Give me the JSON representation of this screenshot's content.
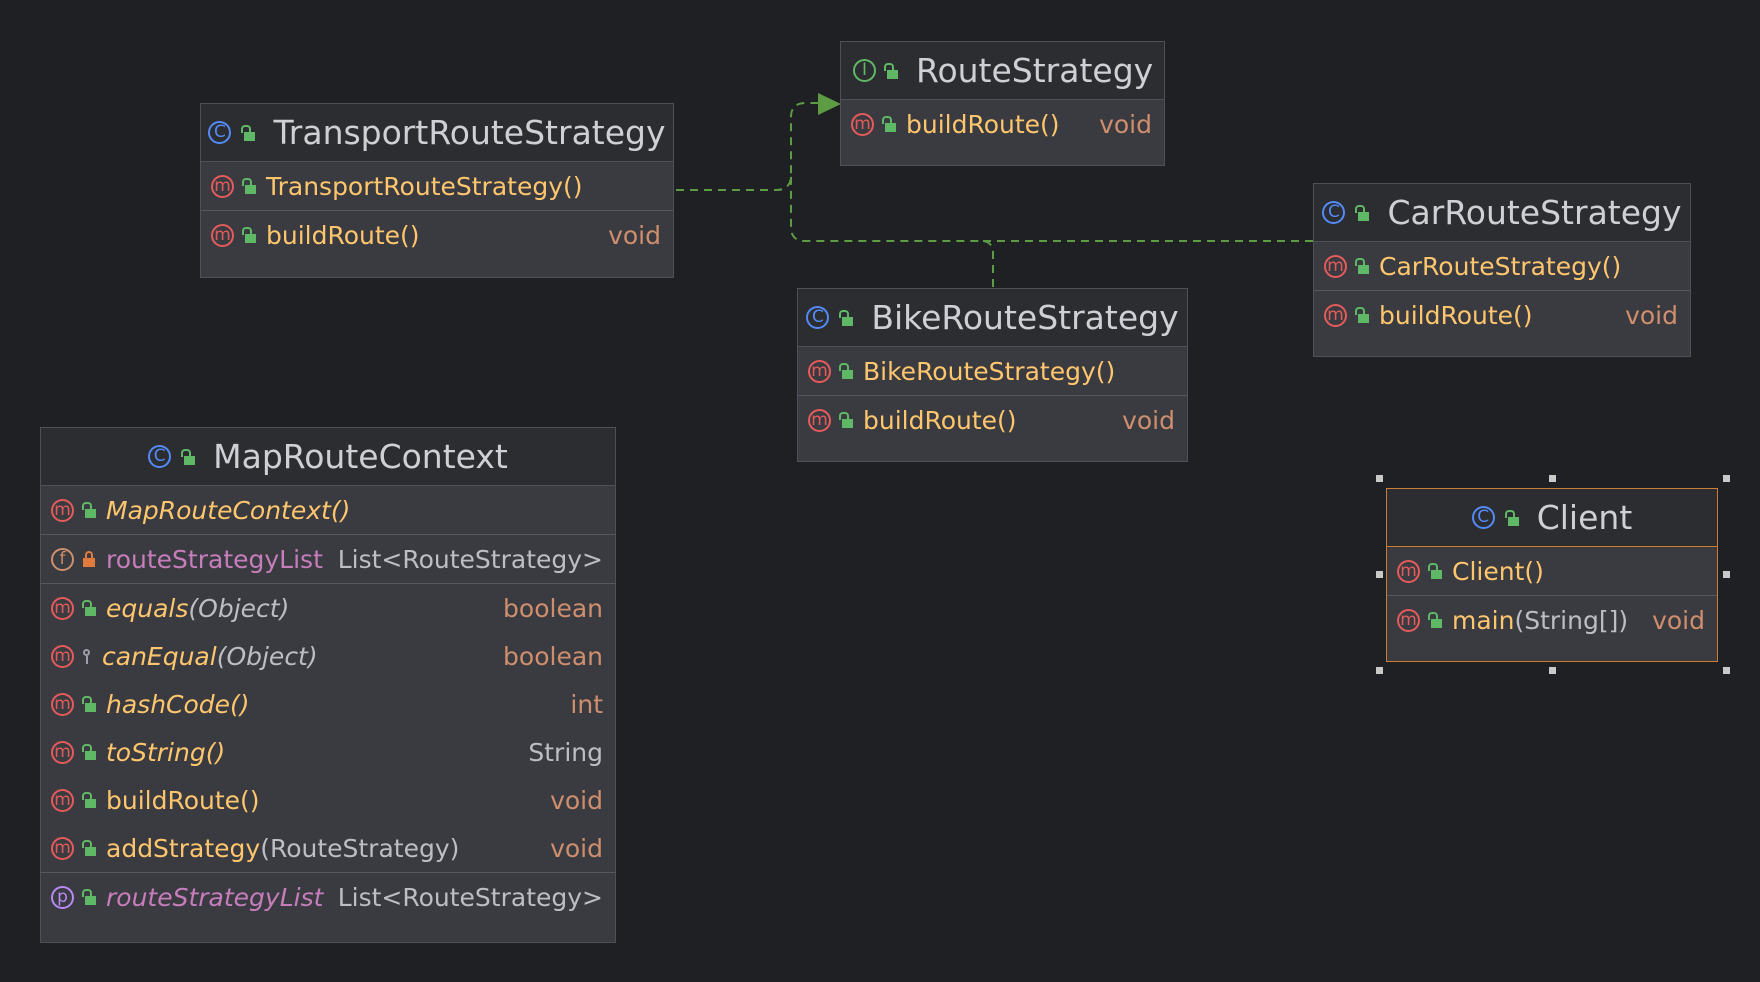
{
  "diagram": {
    "nodes": {
      "route_strategy": {
        "kind": "interface",
        "title": "RouteStrategy",
        "members": [
          {
            "kind": "method-abstract",
            "name": "buildRoute()",
            "type": "void"
          }
        ]
      },
      "transport": {
        "kind": "class",
        "title": "TransportRouteStrategy",
        "members": [
          {
            "kind": "method",
            "name": "TransportRouteStrategy()",
            "type": ""
          },
          {
            "kind": "method",
            "name": "buildRoute()",
            "type": "void"
          }
        ]
      },
      "car": {
        "kind": "class",
        "title": "CarRouteStrategy",
        "members": [
          {
            "kind": "method",
            "name": "CarRouteStrategy()",
            "type": ""
          },
          {
            "kind": "method",
            "name": "buildRoute()",
            "type": "void"
          }
        ]
      },
      "bike": {
        "kind": "class",
        "title": "BikeRouteStrategy",
        "members": [
          {
            "kind": "method",
            "name": "BikeRouteStrategy()",
            "type": ""
          },
          {
            "kind": "method",
            "name": "buildRoute()",
            "type": "void"
          }
        ]
      },
      "map_context": {
        "kind": "class",
        "title": "MapRouteContext",
        "members": [
          {
            "kind": "method",
            "name": "MapRouteContext()",
            "type": ""
          },
          {
            "kind": "field",
            "name": "routeStrategyList",
            "type": "List<RouteStrategy>"
          },
          {
            "kind": "method",
            "name": "equals",
            "params": "(Object)",
            "type": "boolean"
          },
          {
            "kind": "method",
            "name": "canEqual",
            "params": "(Object)",
            "type": "boolean"
          },
          {
            "kind": "method",
            "name": "hashCode()",
            "type": "int"
          },
          {
            "kind": "method",
            "name": "toString()",
            "type": "String"
          },
          {
            "kind": "method",
            "name": "buildRoute()",
            "type": "void"
          },
          {
            "kind": "method",
            "name": "addStrategy",
            "params": "(RouteStrategy)",
            "type": "void"
          },
          {
            "kind": "property",
            "name": "routeStrategyList",
            "type": "List<RouteStrategy>"
          }
        ]
      },
      "client": {
        "kind": "class",
        "title": "Client",
        "selected": true,
        "members": [
          {
            "kind": "method",
            "name": "Client()",
            "type": ""
          },
          {
            "kind": "method",
            "name": "main",
            "params": "(String[])",
            "type": "void"
          }
        ]
      }
    },
    "icons": {
      "class": "class-icon",
      "interface": "interface-icon",
      "method": "method-icon",
      "field": "field-icon",
      "property": "property-icon",
      "public": "public-visibility-icon",
      "private": "private-visibility-icon",
      "protected": "protected-visibility-icon"
    },
    "icon_glyphs": {
      "class": "C",
      "interface": "I",
      "method": "m",
      "field": "f",
      "property": "p"
    },
    "edges": [
      {
        "from": "TransportRouteStrategy",
        "to": "RouteStrategy",
        "relation": "implements"
      },
      {
        "from": "BikeRouteStrategy",
        "to": "RouteStrategy",
        "relation": "implements"
      },
      {
        "from": "CarRouteStrategy",
        "to": "RouteStrategy",
        "relation": "implements"
      }
    ],
    "colors": {
      "background": "#1f2023",
      "node_fill": "#393b40",
      "edge": "#5e9c44",
      "selection": "#c77d37"
    }
  }
}
